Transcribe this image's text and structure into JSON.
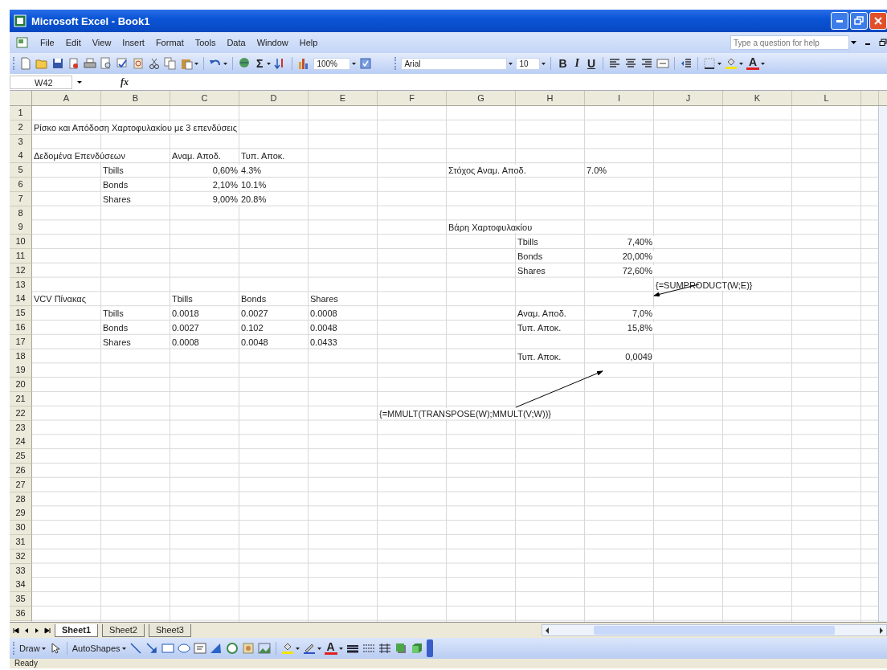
{
  "window": {
    "title": "Microsoft Excel - Book1"
  },
  "menu": [
    "File",
    "Edit",
    "View",
    "Insert",
    "Format",
    "Tools",
    "Data",
    "Window",
    "Help"
  ],
  "help_field": {
    "placeholder": "Type a question for help"
  },
  "standard_toolbar": {
    "autosum": "Σ",
    "zoom": "100%"
  },
  "formatting_toolbar": {
    "font": "Arial",
    "size": "10",
    "style_buttons": [
      "B",
      "I",
      "U"
    ],
    "font_color": "A"
  },
  "formula_bar": {
    "name_box": "W42",
    "function_label": "fx"
  },
  "columns": [
    "A",
    "B",
    "C",
    "D",
    "E",
    "F",
    "G",
    "H",
    "I",
    "J",
    "K",
    "L"
  ],
  "rows": [
    {
      "label": "1"
    },
    {
      "label": "2",
      "cells": [
        {
          "text": "Ρίσκο και Απόδοση Χαρτοφυλακίου με 3 επενδύσεις",
          "kind": "text"
        }
      ]
    },
    {
      "label": "3"
    },
    {
      "label": "4",
      "cells": [
        {
          "text": "Δεδομένα Επενδύσεων",
          "kind": "text"
        },
        null,
        {
          "text": "Αναμ. Αποδ.",
          "kind": "text"
        },
        {
          "text": "Τυπ. Αποκ.",
          "kind": "text"
        }
      ]
    },
    {
      "label": "5",
      "cells": [
        null,
        {
          "text": "Tbills",
          "kind": "text"
        },
        {
          "text": "0,60%",
          "kind": "number"
        },
        {
          "text": "4.3%",
          "kind": "text"
        },
        null,
        null,
        {
          "text": "Στόχος Αναμ. Αποδ.",
          "kind": "text"
        },
        null,
        {
          "text": "7.0%",
          "kind": "text"
        }
      ]
    },
    {
      "label": "6",
      "cells": [
        null,
        {
          "text": "Bonds",
          "kind": "text"
        },
        {
          "text": "2,10%",
          "kind": "number"
        },
        {
          "text": "10.1%",
          "kind": "text"
        }
      ]
    },
    {
      "label": "7",
      "cells": [
        null,
        {
          "text": "Shares",
          "kind": "text"
        },
        {
          "text": "9,00%",
          "kind": "number"
        },
        {
          "text": "20.8%",
          "kind": "text"
        }
      ]
    },
    {
      "label": "8"
    },
    {
      "label": "9",
      "cells": [
        null,
        null,
        null,
        null,
        null,
        null,
        {
          "text": "Βάρη Χαρτοφυλακίου",
          "kind": "text"
        }
      ]
    },
    {
      "label": "10",
      "cells": [
        null,
        null,
        null,
        null,
        null,
        null,
        null,
        {
          "text": "Tbills",
          "kind": "text"
        },
        {
          "text": "7,40%",
          "kind": "number"
        }
      ]
    },
    {
      "label": "11",
      "cells": [
        null,
        null,
        null,
        null,
        null,
        null,
        null,
        {
          "text": "Bonds",
          "kind": "text"
        },
        {
          "text": "20,00%",
          "kind": "number"
        }
      ]
    },
    {
      "label": "12",
      "cells": [
        null,
        null,
        null,
        null,
        null,
        null,
        null,
        {
          "text": "Shares",
          "kind": "text"
        },
        {
          "text": "72,60%",
          "kind": "number"
        }
      ]
    },
    {
      "label": "13",
      "cells": [
        null,
        null,
        null,
        null,
        null,
        null,
        null,
        null,
        null,
        {
          "text": "{=SUMPRODUCT(W;E)}",
          "kind": "text"
        }
      ]
    },
    {
      "label": "14",
      "cells": [
        {
          "text": "VCV Πίνακας",
          "kind": "text"
        },
        null,
        {
          "text": "Tbills",
          "kind": "text"
        },
        {
          "text": "Bonds",
          "kind": "text"
        },
        {
          "text": "Shares",
          "kind": "text"
        }
      ]
    },
    {
      "label": "15",
      "cells": [
        null,
        {
          "text": "Tbills",
          "kind": "text"
        },
        {
          "text": "0.0018",
          "kind": "text"
        },
        {
          "text": "0.0027",
          "kind": "text"
        },
        {
          "text": "0.0008",
          "kind": "text"
        },
        null,
        null,
        {
          "text": "Αναμ. Αποδ.",
          "kind": "text"
        },
        {
          "text": "7,0%",
          "kind": "number"
        }
      ]
    },
    {
      "label": "16",
      "cells": [
        null,
        {
          "text": "Bonds",
          "kind": "text"
        },
        {
          "text": "0.0027",
          "kind": "text"
        },
        {
          "text": "0.102",
          "kind": "text"
        },
        {
          "text": "0.0048",
          "kind": "text"
        },
        null,
        null,
        {
          "text": "Τυπ. Αποκ.",
          "kind": "text"
        },
        {
          "text": "15,8%",
          "kind": "number"
        }
      ]
    },
    {
      "label": "17",
      "cells": [
        null,
        {
          "text": "Shares",
          "kind": "text"
        },
        {
          "text": "0.0008",
          "kind": "text"
        },
        {
          "text": "0.0048",
          "kind": "text"
        },
        {
          "text": "0.0433",
          "kind": "text"
        }
      ]
    },
    {
      "label": "18",
      "cells": [
        null,
        null,
        null,
        null,
        null,
        null,
        null,
        {
          "text": "Τυπ. Αποκ.",
          "kind": "text"
        },
        {
          "text": "0,0049",
          "kind": "number"
        }
      ]
    },
    {
      "label": "19"
    },
    {
      "label": "20"
    },
    {
      "label": "21"
    },
    {
      "label": "22",
      "cells": [
        null,
        null,
        null,
        null,
        null,
        {
          "text": "{=MMULT(TRANSPOSE(W);MMULT(V;W))}",
          "kind": "text"
        }
      ]
    },
    {
      "label": "23"
    },
    {
      "label": "24"
    },
    {
      "label": "25"
    },
    {
      "label": "26"
    },
    {
      "label": "27"
    },
    {
      "label": "28"
    },
    {
      "label": "29"
    },
    {
      "label": "30"
    },
    {
      "label": "31"
    },
    {
      "label": "32"
    },
    {
      "label": "33"
    },
    {
      "label": "34"
    },
    {
      "label": "35"
    },
    {
      "label": "36"
    }
  ],
  "sheet_tabs": [
    {
      "label": "Sheet1",
      "selected": true
    },
    {
      "label": "Sheet2",
      "selected": false
    },
    {
      "label": "Sheet3",
      "selected": false
    }
  ],
  "drawing_toolbar": {
    "draw": "Draw",
    "autoshapes": "AutoShapes",
    "font_color": "A"
  },
  "status_bar": "Ready"
}
